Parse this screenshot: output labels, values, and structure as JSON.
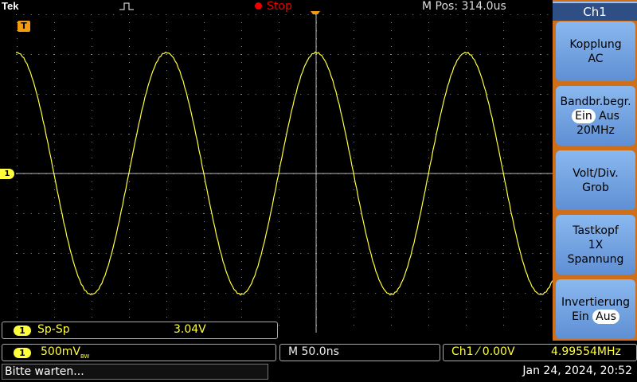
{
  "header": {
    "brand": "Tek",
    "run_state": "Stop",
    "m_pos": "M Pos: 314.0us"
  },
  "markers": {
    "trigger_marker": "T",
    "channel_marker": "1"
  },
  "measurement": {
    "channel": "1",
    "label": "Sp-Sp",
    "value": "3.04V"
  },
  "vertical": {
    "channel": "1",
    "scale": "500mV",
    "bw_indicator": "BW"
  },
  "horizontal": {
    "scale": "M 50.0ns"
  },
  "trigger": {
    "source_level": "Ch1 ⁄ 0.00V",
    "frequency": "4.99554MHz"
  },
  "status": {
    "message": "Bitte warten...",
    "datetime": "Jan 24, 2024, 20:52"
  },
  "side_menu": {
    "title": "Ch1",
    "buttons": [
      {
        "line1": "Kopplung",
        "line2": "AC"
      },
      {
        "line1": "Bandbr.begr.",
        "opt_on": "Ein",
        "opt_off": "Aus",
        "line3": "20MHz"
      },
      {
        "line1": "Volt/Div.",
        "line2": "Grob"
      },
      {
        "line1": "Tastkopf",
        "line2": "1X",
        "line3": "Spannung"
      },
      {
        "line1": "Invertierung",
        "opt_on": "Ein",
        "opt_off": "Aus"
      }
    ]
  },
  "colors": {
    "trace": "#ffff3c",
    "stop": "#e00000",
    "menu_bg": "#cf6f1a",
    "menu_button": "#7aa8e6"
  },
  "waveform": {
    "type": "sine",
    "frequency_mhz": 4.99554,
    "peak_to_peak_v": 3.04,
    "volts_per_div": 0.5,
    "time_per_div_ns": 50
  }
}
